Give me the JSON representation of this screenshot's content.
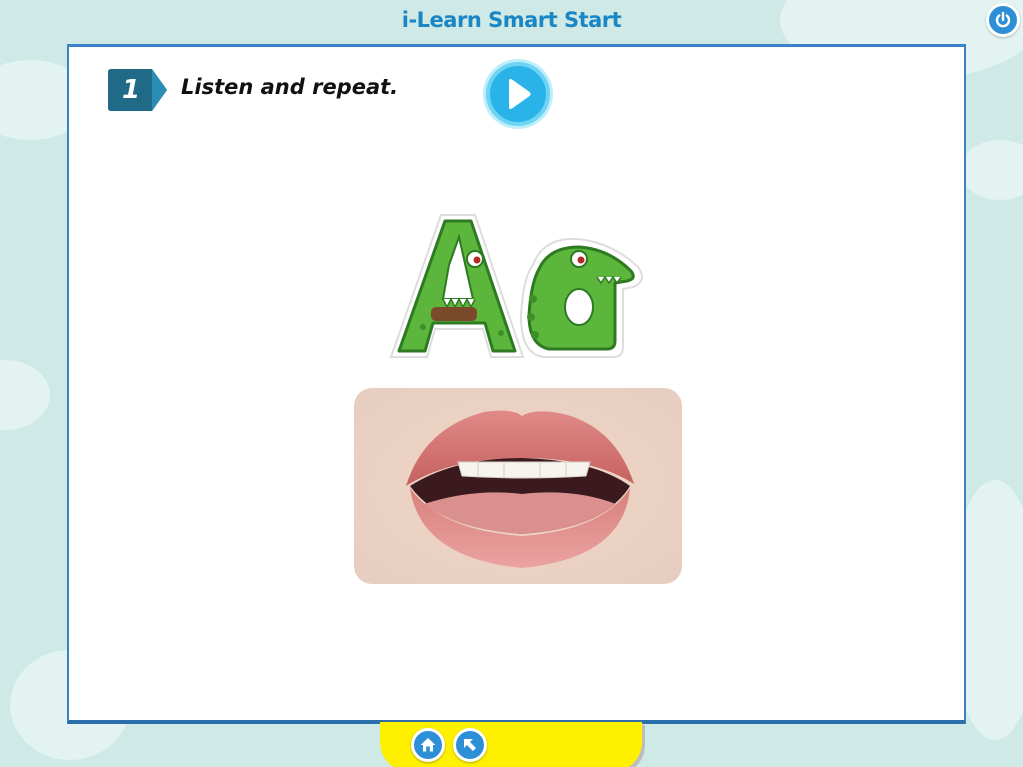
{
  "app": {
    "title": "i-Learn Smart Start"
  },
  "activity": {
    "number": "1",
    "instruction": "Listen and repeat."
  },
  "letters": {
    "upper": "A",
    "lower": "a"
  },
  "colors": {
    "background": "#cfe9e6",
    "title": "#1a86c4",
    "panel_border": "#3a82c4",
    "badge": "#1f6a86",
    "play_button": "#29b3e8",
    "nav_button": "#2d8fd6",
    "bottom_bar": "#fff000",
    "crocodile_green": "#5cb63c"
  },
  "icons": {
    "power": "power-icon",
    "play": "play-icon",
    "home": "home-icon",
    "back": "back-arrow-icon"
  }
}
